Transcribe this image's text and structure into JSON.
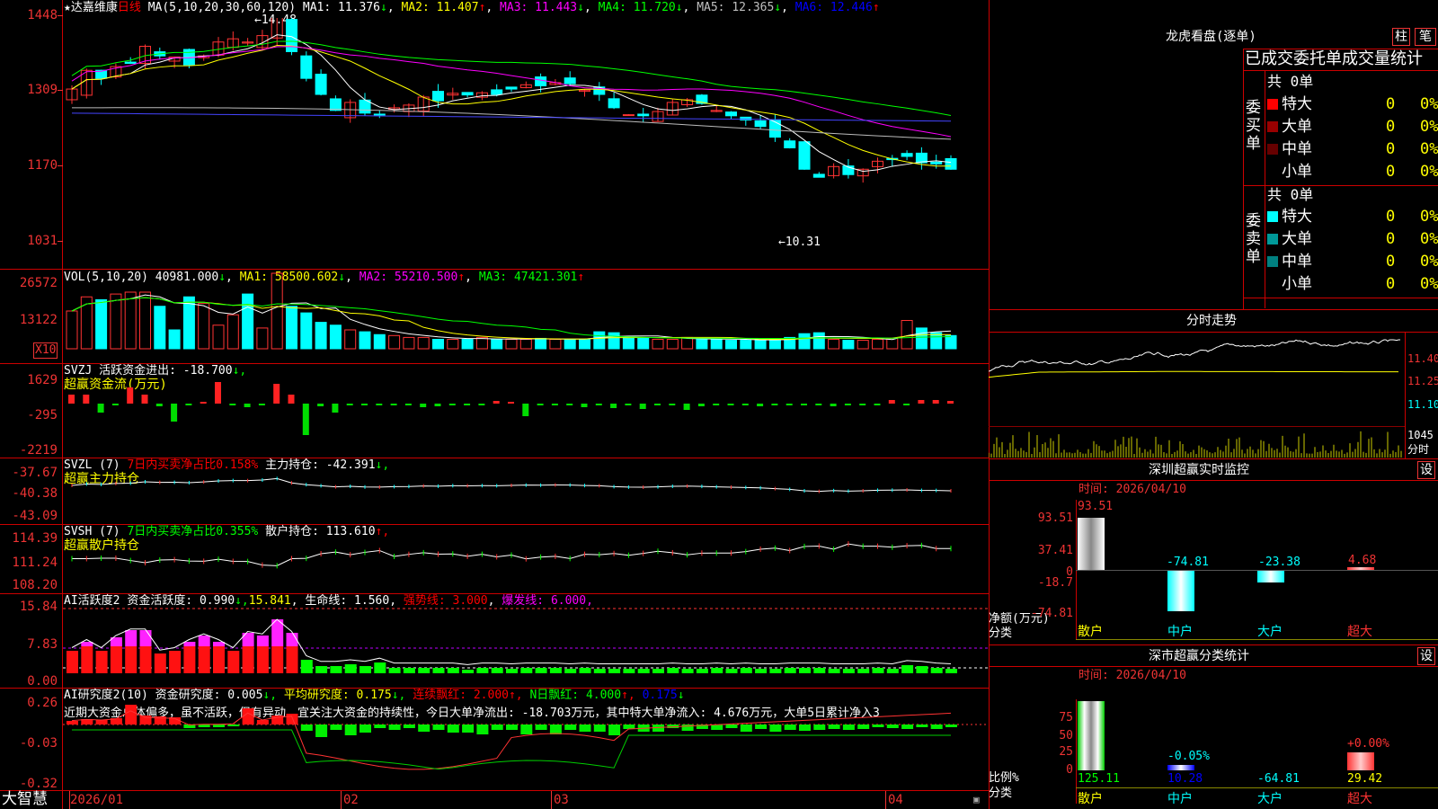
{
  "header": {
    "star": "★",
    "stock_name": "达嘉维康",
    "period": "日线",
    "ma_label": "MA(5,10,20,30,60,120)",
    "ma": [
      {
        "label": "MA1:",
        "value": "11.376",
        "arrow": "↓",
        "color": "#ffffff"
      },
      {
        "label": "MA2:",
        "value": "11.407",
        "arrow": "↑",
        "color": "#ffff00"
      },
      {
        "label": "MA3:",
        "value": "11.443",
        "arrow": "↓",
        "color": "#ff00ff"
      },
      {
        "label": "MA4:",
        "value": "11.720",
        "arrow": "↓",
        "color": "#00ff00"
      },
      {
        "label": "MA5:",
        "value": "12.365",
        "arrow": "↓",
        "color": "#c0c0c0"
      },
      {
        "label": "MA6:",
        "value": "12.446",
        "arrow": "↑",
        "color": "#0000ff"
      }
    ],
    "high_mark": "←14.48",
    "low_mark": "←10.31"
  },
  "price_axis": [
    "1448",
    "1309",
    "1170",
    "1031"
  ],
  "vol": {
    "label": "VOL(5,10,20)",
    "value": "40981.000",
    "arrow": "↓",
    "ma1": "MA1: 58500.602",
    "ma1_arrow": "↓",
    "ma2": "MA2: 55210.500",
    "ma2_arrow": "↑",
    "ma3": "MA3: 47421.301",
    "ma3_arrow": "↑",
    "axis": [
      "26572",
      "13122"
    ],
    "unit": "X10"
  },
  "svzj": {
    "label": "SVZJ",
    "desc": "活跃资金进出: -18.700",
    "arrow": "↓,",
    "name": "超赢资金流(万元)",
    "axis": [
      "1629",
      "-295",
      "-2219"
    ]
  },
  "svzl": {
    "label": "SVZL (7)",
    "net": "7日内买卖净占比0.158%",
    "hold": "主力持仓: -42.391",
    "arrow": "↓,",
    "name": "超赢主力持仓",
    "axis": [
      "-37.67",
      "-40.38",
      "-43.09"
    ]
  },
  "svsh": {
    "label": "SVSH (7)",
    "net": "7日内买卖净占比0.355%",
    "hold": "散户持仓: 113.610",
    "arrow": "↑,",
    "name": "超赢散户持仓",
    "axis": [
      "114.39",
      "111.24",
      "108.20"
    ]
  },
  "ai1": {
    "label": "AI活跃度2",
    "fund": "资金活跃度: 0.990",
    "fund_arrow": "↓,",
    "v2": "15.841",
    "life": "生命线: 1.560",
    "strong": "强势线: 3.000",
    "burst": "爆发线: 6.000,",
    "axis": [
      "15.84",
      "7.83",
      "0.00"
    ]
  },
  "ai2": {
    "label": "AI研究度2(10)",
    "fund": "资金研究度: 0.005",
    "fund_arrow": "↓,",
    "avg": "平均研究度: 0.175",
    "avg_arrow": "↓,",
    "cont": "连续飘红: 2.000",
    "cont_arrow": "↑,",
    "nday": "N日飘红: 4.000",
    "nday_arrow": "↑,",
    "v5": "0.175",
    "v5_arrow": "↓",
    "summary": "近期大资金总体偏多，虽不活跃，但有异动，宜关注大资金的持续性，今日大单净流出: -18.703万元，其中特大单净流入: 4.676万元，大单5日累计净入3",
    "axis": [
      "0.26",
      "-0.03",
      "-0.32"
    ]
  },
  "xaxis": [
    "2026/01",
    "02",
    "03",
    "04"
  ],
  "brand": "大智慧",
  "lhb": {
    "title": "龙虎看盘(逐单)",
    "btn1": "柱",
    "btn2": "笔",
    "header": "已成交委托单成交量统计",
    "buy_label": "委买单",
    "sell_label": "委卖单",
    "count": "共 0单",
    "buy_rows": [
      {
        "name": "特大",
        "color": "#ff0000",
        "n": "0",
        "p": "0%"
      },
      {
        "name": "大单",
        "color": "#990000",
        "n": "0",
        "p": "0%"
      },
      {
        "name": "中单",
        "color": "#660000",
        "n": "0",
        "p": "0%"
      },
      {
        "name": "小单",
        "color": "",
        "n": "0",
        "p": "0%"
      }
    ],
    "sell_rows": [
      {
        "name": "特大",
        "color": "#00ffff",
        "n": "0",
        "p": "0%"
      },
      {
        "name": "大单",
        "color": "#009999",
        "n": "0",
        "p": "0%"
      },
      {
        "name": "中单",
        "color": "#008080",
        "n": "0",
        "p": "0%"
      },
      {
        "name": "小单",
        "color": "",
        "n": "0",
        "p": "0%"
      }
    ]
  },
  "intraday": {
    "title": "分时走势",
    "axis": [
      "11.40",
      "11.25",
      "11.10"
    ],
    "vol_label": "1045",
    "unit": "分时"
  },
  "monitor": {
    "title": "深圳超赢实时监控",
    "btn": "设",
    "time": "时间: 2026/04/10",
    "axis": [
      "93.51",
      "37.41",
      "0",
      "-18.7",
      "-74.81"
    ],
    "ylabel": "净额(万元)",
    "xlabel": "分类",
    "cats": [
      "散户",
      "中户",
      "大户",
      "超大"
    ],
    "values": [
      "93.51",
      "-74.81",
      "-23.38",
      "4.68"
    ],
    "nums": [
      93.51,
      -74.81,
      -23.38,
      4.68
    ]
  },
  "stats": {
    "title": "深市超赢分类统计",
    "btn": "设",
    "time": "时间: 2026/04/10",
    "axis": [
      "75",
      "50",
      "25",
      "0"
    ],
    "ylabel": "比例%",
    "xlabel": "分类",
    "cats": [
      "散户",
      "中户",
      "大户",
      "超大"
    ],
    "values": [
      "125.11",
      "10.28",
      "-64.81",
      "29.42"
    ],
    "tops": [
      "",
      "-0.05%",
      "",
      "+0.00%"
    ],
    "nums": [
      125.11,
      10.28,
      -64.81,
      29.42
    ]
  }
}
